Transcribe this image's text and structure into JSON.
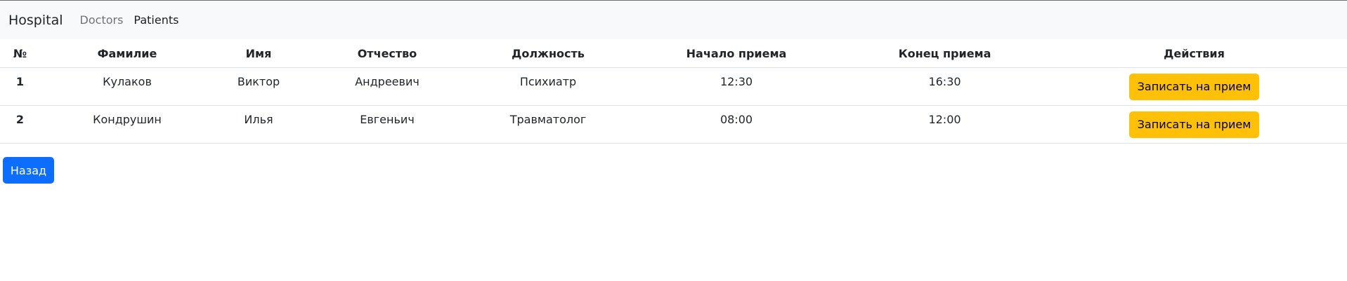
{
  "navbar": {
    "brand": "Hospital",
    "links": [
      {
        "label": "Doctors"
      },
      {
        "label": "Patients"
      }
    ]
  },
  "table": {
    "headers": [
      "№",
      "Фамилие",
      "Имя",
      "Отчество",
      "Должность",
      "Начало приема",
      "Конец приема",
      "Действия"
    ],
    "rows": [
      {
        "num": "1",
        "last_name": "Кулаков",
        "first_name": "Виктор",
        "patronymic": "Андреевич",
        "position": "Психиатр",
        "start": "12:30",
        "end": "16:30",
        "action_label": "Записать на прием"
      },
      {
        "num": "2",
        "last_name": "Кондрушин",
        "first_name": "Илья",
        "patronymic": "Евгеньич",
        "position": "Травматолог",
        "start": "08:00",
        "end": "12:00",
        "action_label": "Записать на прием"
      }
    ]
  },
  "back_button": {
    "label": "Назад"
  },
  "colors": {
    "navbar_bg": "#f8f9fa",
    "warning": "#ffc107",
    "primary": "#0d6efd",
    "border": "#dee2e6"
  }
}
